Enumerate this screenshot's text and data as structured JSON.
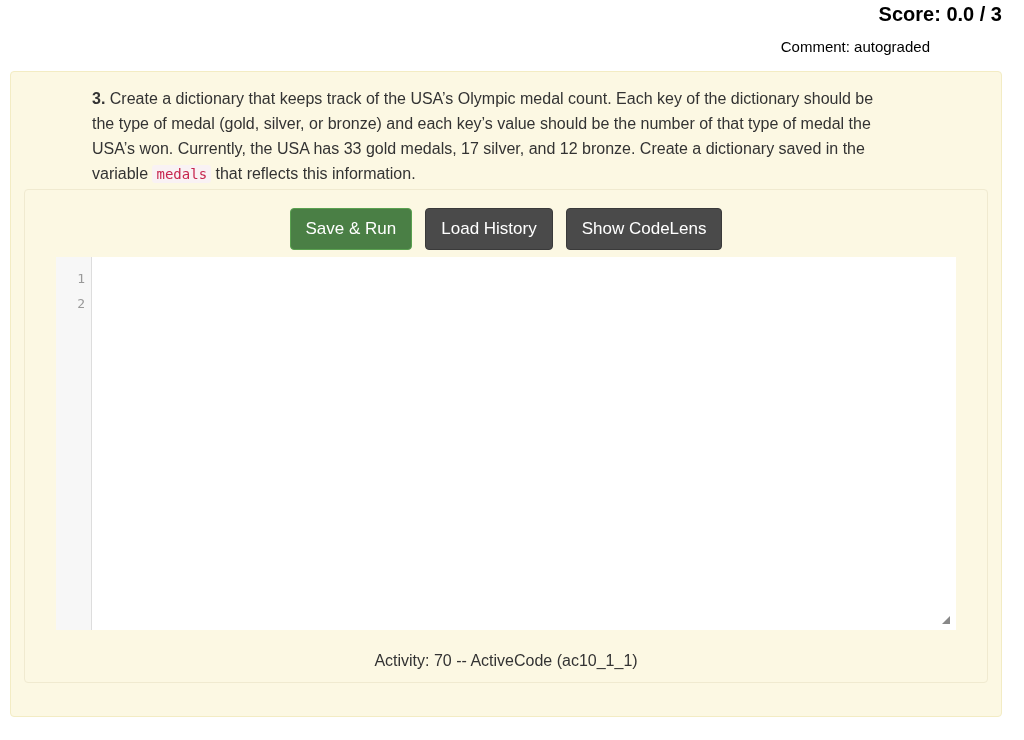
{
  "score": "Score: 0.0 / 3",
  "comment": "Comment: autograded",
  "question": {
    "text": "**3.** Create a dictionary that keeps track of the USA’s Olympic medal count. Each key of the dictionary should be the type of medal (gold, silver, or bronze) and each key’s value should be the number of that type of medal the USA’s won. Currently, the USA has 33 gold medals, 17 silver, and 12 bronze. Create a dictionary saved in the variable",
    "code": "medals",
    "after": "that reflects this information."
  },
  "buttons": [
    {
      "label": "Save & Run",
      "kind": "primary"
    },
    {
      "label": "Load History",
      "kind": "secondary"
    },
    {
      "label": "Show CodeLens",
      "kind": "secondary"
    }
  ],
  "editor": {
    "line_numbers": [
      "1",
      "2"
    ]
  },
  "activity": "Activity: 70 -- ActiveCode (ac10_1_1)"
}
